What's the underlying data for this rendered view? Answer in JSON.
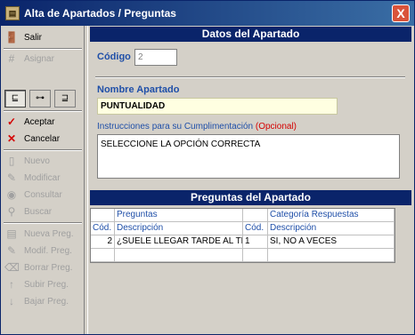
{
  "window": {
    "title": "Alta de Apartados / Preguntas",
    "close": "X"
  },
  "toolbar": {
    "salir": "Salir",
    "asignar": "Asignar",
    "aceptar": "Aceptar",
    "cancelar": "Cancelar",
    "nuevo": "Nuevo",
    "modificar": "Modificar",
    "consultar": "Consultar",
    "buscar": "Buscar",
    "nueva_preg": "Nueva Preg.",
    "modif_preg": "Modif. Preg.",
    "borrar_preg": "Borrar Preg.",
    "subir_preg": "Subir Preg.",
    "bajar_preg": "Bajar Preg."
  },
  "datos": {
    "section_title": "Datos del Apartado",
    "codigo_label": "Código",
    "codigo_value": "2",
    "nombre_label": "Nombre Apartado",
    "nombre_value": "PUNTUALIDAD",
    "instr_label": "Instrucciones para su Cumplimentación",
    "instr_optional": "(Opcional)",
    "instr_value": "SELECCIONE LA OPCIÓN CORRECTA"
  },
  "preguntas": {
    "section_title": "Preguntas del Apartado",
    "group_headers": [
      "",
      "Preguntas",
      "",
      "Categoría Respuestas"
    ],
    "headers": [
      "Cód.",
      "Descripción",
      "Cód.",
      "Descripción"
    ],
    "rows": [
      [
        "2",
        "¿SUELE LLEGAR TARDE AL TRABAJO?",
        "1",
        "SI, NO A VECES"
      ]
    ]
  }
}
